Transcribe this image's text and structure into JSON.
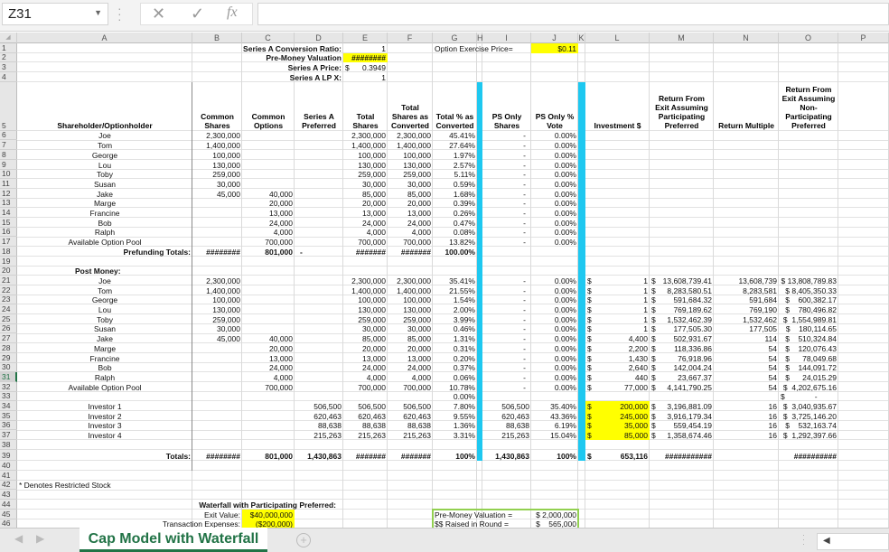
{
  "formula_bar": {
    "name_box": "Z31",
    "cancel_icon": "✕",
    "enter_icon": "✓",
    "fx_label": "fx",
    "formula": ""
  },
  "columns": [
    "A",
    "B",
    "C",
    "D",
    "E",
    "F",
    "G",
    "H",
    "I",
    "J",
    "K",
    "L",
    "M",
    "N",
    "O",
    "P"
  ],
  "rows": [
    "1",
    "2",
    "3",
    "4",
    "5",
    "6",
    "7",
    "8",
    "9",
    "10",
    "11",
    "12",
    "13",
    "14",
    "15",
    "16",
    "17",
    "18",
    "19",
    "20",
    "21",
    "22",
    "23",
    "24",
    "25",
    "26",
    "27",
    "28",
    "29",
    "30",
    "31",
    "32",
    "33",
    "34",
    "35",
    "36",
    "37",
    "38",
    "39",
    "40",
    "41",
    "42",
    "43",
    "44",
    "45",
    "46"
  ],
  "top": {
    "conv_ratio_label": "Series A Conversion Ratio:",
    "conv_ratio": "1",
    "premoney_label": "Pre-Money Valuation",
    "premoney": "########",
    "price_label": "Series A Price:",
    "price_dollar": "$",
    "price": "0.3949",
    "lpx_label": "Series A LP X:",
    "lpx": "1",
    "option_price_label": "Option Exercise Price=",
    "option_price": "$0.11"
  },
  "headers": {
    "A": "Shareholder/Optionholder",
    "B": "Common\nShares",
    "C": "Common\nOptions",
    "D": "Series A\nPreferred",
    "E": "Total\nShares",
    "F": "Total\nShares as\nConverted",
    "G": "Total % as\nConverted",
    "I": "PS Only\nShares",
    "J": "PS Only %\nVote",
    "L": "Investment $",
    "M": "Return From\nExit Assuming\nParticipating\nPreferred",
    "N": "Return Multiple",
    "O": "Return From\nExit Assuming\nNon-\nParticipating\nPreferred"
  },
  "prefunding": [
    {
      "name": "Joe",
      "B": "2,300,000",
      "C": "",
      "E": "2,300,000",
      "F": "2,300,000",
      "G": "45.41%",
      "I": "-",
      "J": "0.00%"
    },
    {
      "name": "Tom",
      "B": "1,400,000",
      "C": "",
      "E": "1,400,000",
      "F": "1,400,000",
      "G": "27.64%",
      "I": "-",
      "J": "0.00%"
    },
    {
      "name": "George",
      "B": "100,000",
      "C": "",
      "E": "100,000",
      "F": "100,000",
      "G": "1.97%",
      "I": "-",
      "J": "0.00%"
    },
    {
      "name": "Lou",
      "B": "130,000",
      "C": "",
      "E": "130,000",
      "F": "130,000",
      "G": "2.57%",
      "I": "-",
      "J": "0.00%"
    },
    {
      "name": "Toby",
      "B": "259,000",
      "C": "",
      "E": "259,000",
      "F": "259,000",
      "G": "5.11%",
      "I": "-",
      "J": "0.00%"
    },
    {
      "name": "Susan",
      "B": "30,000",
      "C": "",
      "E": "30,000",
      "F": "30,000",
      "G": "0.59%",
      "I": "-",
      "J": "0.00%"
    },
    {
      "name": "Jake",
      "B": "45,000",
      "C": "40,000",
      "E": "85,000",
      "F": "85,000",
      "G": "1.68%",
      "I": "-",
      "J": "0.00%"
    },
    {
      "name": "Marge",
      "B": "",
      "C": "20,000",
      "E": "20,000",
      "F": "20,000",
      "G": "0.39%",
      "I": "-",
      "J": "0.00%"
    },
    {
      "name": "Francine",
      "B": "",
      "C": "13,000",
      "E": "13,000",
      "F": "13,000",
      "G": "0.26%",
      "I": "-",
      "J": "0.00%"
    },
    {
      "name": "Bob",
      "B": "",
      "C": "24,000",
      "E": "24,000",
      "F": "24,000",
      "G": "0.47%",
      "I": "-",
      "J": "0.00%"
    },
    {
      "name": "Ralph",
      "B": "",
      "C": "4,000",
      "E": "4,000",
      "F": "4,000",
      "G": "0.08%",
      "I": "-",
      "J": "0.00%"
    },
    {
      "name": "Available Option Pool",
      "B": "",
      "C": "700,000",
      "E": "700,000",
      "F": "700,000",
      "G": "13.82%",
      "I": "-",
      "J": "0.00%"
    }
  ],
  "prefunding_totals": {
    "label": "Prefunding Totals:",
    "B": "########",
    "C": "801,000",
    "D": "-",
    "E": "#######",
    "F": "#######",
    "G": "100.00%"
  },
  "post_money_label": "Post Money:",
  "postmoney": [
    {
      "name": "Joe",
      "B": "2,300,000",
      "C": "",
      "D": "",
      "E": "2,300,000",
      "F": "2,300,000",
      "G": "35.41%",
      "I": "-",
      "J": "0.00%",
      "L": "1",
      "M": "13,608,739.41",
      "N": "13,608,739",
      "O": "$ 13,808,789.83"
    },
    {
      "name": "Tom",
      "B": "1,400,000",
      "C": "",
      "D": "",
      "E": "1,400,000",
      "F": "1,400,000",
      "G": "21.55%",
      "I": "-",
      "J": "0.00%",
      "L": "1",
      "M": "8,283,580.51",
      "N": "8,283,581",
      "O": "$ 8,405,350.33"
    },
    {
      "name": "George",
      "B": "100,000",
      "C": "",
      "D": "",
      "E": "100,000",
      "F": "100,000",
      "G": "1.54%",
      "I": "-",
      "J": "0.00%",
      "L": "1",
      "M": "591,684.32",
      "N": "591,684",
      "O": "$    600,382.17"
    },
    {
      "name": "Lou",
      "B": "130,000",
      "C": "",
      "D": "",
      "E": "130,000",
      "F": "130,000",
      "G": "2.00%",
      "I": "-",
      "J": "0.00%",
      "L": "1",
      "M": "769,189.62",
      "N": "769,190",
      "O": "$    780,496.82"
    },
    {
      "name": "Toby",
      "B": "259,000",
      "C": "",
      "D": "",
      "E": "259,000",
      "F": "259,000",
      "G": "3.99%",
      "I": "-",
      "J": "0.00%",
      "L": "1",
      "M": "1,532,462.39",
      "N": "1,532,462",
      "O": "$  1,554,989.81"
    },
    {
      "name": "Susan",
      "B": "30,000",
      "C": "",
      "D": "",
      "E": "30,000",
      "F": "30,000",
      "G": "0.46%",
      "I": "-",
      "J": "0.00%",
      "L": "1",
      "M": "177,505.30",
      "N": "177,505",
      "O": "$    180,114.65"
    },
    {
      "name": "Jake",
      "B": "45,000",
      "C": "40,000",
      "D": "",
      "E": "85,000",
      "F": "85,000",
      "G": "1.31%",
      "I": "-",
      "J": "0.00%",
      "L": "4,400",
      "M": "502,931.67",
      "N": "114",
      "O": "$    510,324.84"
    },
    {
      "name": "Marge",
      "B": "",
      "C": "20,000",
      "D": "",
      "E": "20,000",
      "F": "20,000",
      "G": "0.31%",
      "I": "-",
      "J": "0.00%",
      "L": "2,200",
      "M": "118,336.86",
      "N": "54",
      "O": "$    120,076.43"
    },
    {
      "name": "Francine",
      "B": "",
      "C": "13,000",
      "D": "",
      "E": "13,000",
      "F": "13,000",
      "G": "0.20%",
      "I": "-",
      "J": "0.00%",
      "L": "1,430",
      "M": "76,918.96",
      "N": "54",
      "O": "$      78,049.68"
    },
    {
      "name": "Bob",
      "B": "",
      "C": "24,000",
      "D": "",
      "E": "24,000",
      "F": "24,000",
      "G": "0.37%",
      "I": "-",
      "J": "0.00%",
      "L": "2,640",
      "M": "142,004.24",
      "N": "54",
      "O": "$    144,091.72"
    },
    {
      "name": "Ralph",
      "B": "",
      "C": "4,000",
      "D": "",
      "E": "4,000",
      "F": "4,000",
      "G": "0.06%",
      "I": "-",
      "J": "0.00%",
      "L": "440",
      "M": "23,667.37",
      "N": "54",
      "O": "$      24,015.29"
    },
    {
      "name": "Available Option Pool",
      "B": "",
      "C": "700,000",
      "D": "",
      "E": "700,000",
      "F": "700,000",
      "G": "10.78%",
      "I": "-",
      "J": "0.00%",
      "L": "77,000",
      "M": "4,141,790.25",
      "N": "54",
      "O": "$  4,202,675.16"
    }
  ],
  "row33": {
    "G": "0.00%",
    "O": "$              -"
  },
  "investors": [
    {
      "name": "Investor 1",
      "D": "506,500",
      "E": "506,500",
      "F": "506,500",
      "G": "7.80%",
      "I": "506,500",
      "J": "35.40%",
      "L": "200,000",
      "M": "3,196,881.09",
      "N": "16",
      "O": "$  3,040,935.67"
    },
    {
      "name": "Investor 2",
      "D": "620,463",
      "E": "620,463",
      "F": "620,463",
      "G": "9.55%",
      "I": "620,463",
      "J": "43.36%",
      "L": "245,000",
      "M": "3,916,179.34",
      "N": "16",
      "O": "$  3,725,146.20"
    },
    {
      "name": "Investor 3",
      "D": "88,638",
      "E": "88,638",
      "F": "88,638",
      "G": "1.36%",
      "I": "88,638",
      "J": "6.19%",
      "L": "35,000",
      "M": "559,454.19",
      "N": "16",
      "O": "$    532,163.74"
    },
    {
      "name": "Investor 4",
      "D": "215,263",
      "E": "215,263",
      "F": "215,263",
      "G": "3.31%",
      "I": "215,263",
      "J": "15.04%",
      "L": "85,000",
      "M": "1,358,674.46",
      "N": "16",
      "O": "$  1,292,397.66"
    }
  ],
  "totals": {
    "label": "Totals:",
    "B": "########",
    "C": "801,000",
    "D": "1,430,863",
    "E": "#######",
    "F": "#######",
    "G": "100%",
    "I": "1,430,863",
    "J": "100%",
    "L_dollar": "$",
    "L": "653,116",
    "M": "###########",
    "O": "##########"
  },
  "footnote": "* Denotes Restricted Stock",
  "waterfall": {
    "title": "Waterfall with Participating Preferred:",
    "exit_label": "Exit Value:",
    "exit_value": "$40,000,000",
    "expenses_label": "Transaction Expenses:",
    "expenses_value": "($200,000)",
    "premoney_label": "Pre-Money Valuation =",
    "premoney_value": "$ 2,000,000",
    "raised_label": "$$ Raised in Round =",
    "raised_value": "$    565,000"
  },
  "currency_symbol": "$",
  "colors": {
    "highlight": "#ffff00",
    "separator": "#1ec8f0",
    "accent": "#217346",
    "box": "#92d050"
  },
  "sheet_tabs": [
    {
      "label": "Cap Model with Waterfall",
      "active": true
    }
  ],
  "add_sheet_icon": "+"
}
